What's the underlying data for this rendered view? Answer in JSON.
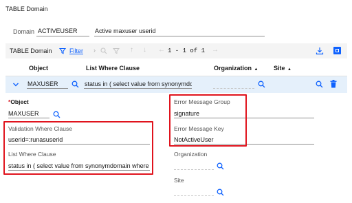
{
  "page_title": "TABLE Domain",
  "domain": {
    "label": "Domain",
    "value": "ACTIVEUSER",
    "description": "Active maxuser userid"
  },
  "table": {
    "title": "TABLE Domain",
    "filter_label": "Filter",
    "pagination": "1 - 1 of 1",
    "columns": {
      "object": "Object",
      "list_where": "List Where Clause",
      "organization": "Organization",
      "site": "Site"
    },
    "row": {
      "object": "MAXUSER",
      "list_where": "status in ( select value from synonymdom"
    }
  },
  "details": {
    "object_label": "Object",
    "object_required_mark": "*",
    "object_value": "MAXUSER",
    "validation_label": "Validation Where Clause",
    "validation_value": "userid=:runasuserid",
    "list_where_label": "List Where Clause",
    "list_where_value": "status in ( select value from synonymdomain where d",
    "error_group_label": "Error Message Group",
    "error_group_value": "signature",
    "error_key_label": "Error Message Key",
    "error_key_value": "NotActiveUser",
    "organization_label": "Organization",
    "site_label": "Site"
  },
  "colors": {
    "accent": "#0f62fe",
    "highlight_row": "#e5f0fb",
    "annotation_red": "#e0131d"
  },
  "icons": {
    "filter": "filter-icon",
    "search": "search-icon",
    "clear_filter": "clear-filter-icon",
    "arrow_up": "arrow-up-icon",
    "arrow_down": "arrow-down-icon",
    "prev": "arrow-left-icon",
    "next": "arrow-right-icon",
    "download": "download-icon",
    "maximize": "maximize-icon",
    "chevron": "chevron-down-icon",
    "delete": "trash-icon",
    "sort_up": "sort-ascending-icon"
  }
}
